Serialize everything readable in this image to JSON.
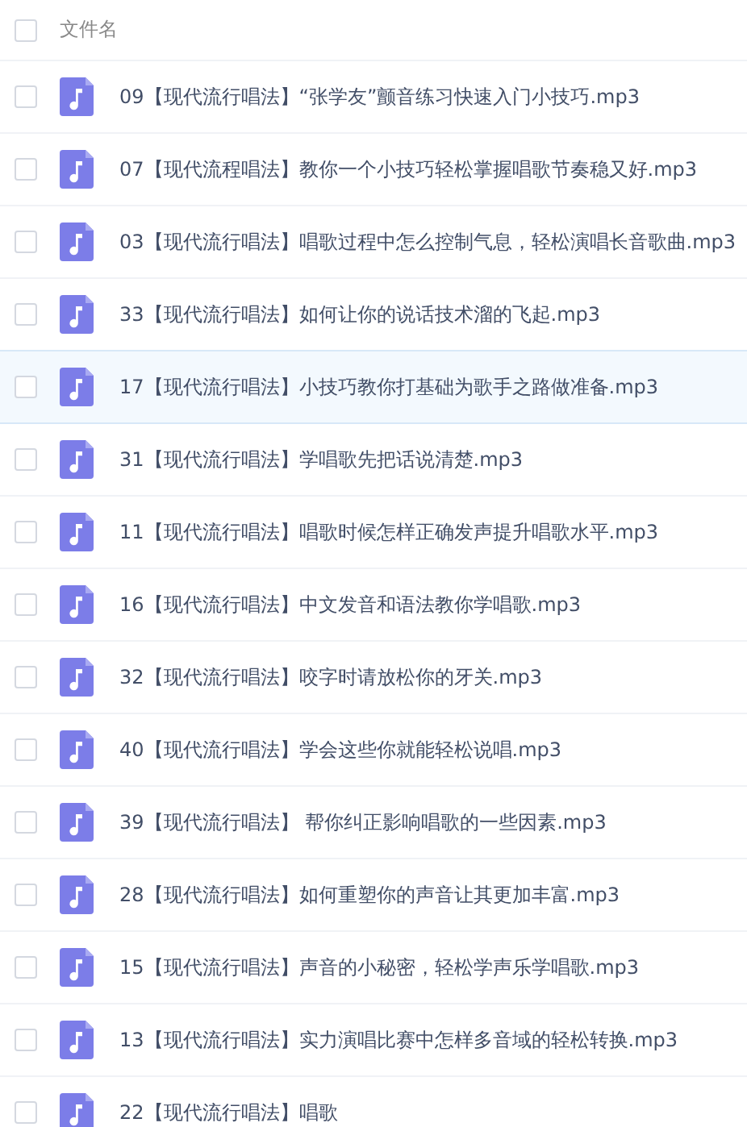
{
  "header": {
    "label": "文件名",
    "checked": false
  },
  "files": [
    {
      "name": "09【现代流行唱法】“张学友”颤音练习快速入门小技巧.mp3",
      "checked": false,
      "highlighted": false
    },
    {
      "name": "07【现代流程唱法】教你一个小技巧轻松掌握唱歌节奏稳又好.mp3",
      "checked": false,
      "highlighted": false
    },
    {
      "name": "03【现代流行唱法】唱歌过程中怎么控制气息，轻松演唱长音歌曲.mp3",
      "checked": false,
      "highlighted": false
    },
    {
      "name": "33【现代流行唱法】如何让你的说话技术溜的飞起.mp3",
      "checked": false,
      "highlighted": false
    },
    {
      "name": "17【现代流行唱法】小技巧教你打基础为歌手之路做准备.mp3",
      "checked": false,
      "highlighted": true
    },
    {
      "name": "31【现代流行唱法】学唱歌先把话说清楚.mp3",
      "checked": false,
      "highlighted": false
    },
    {
      "name": "11【现代流行唱法】唱歌时候怎样正确发声提升唱歌水平.mp3",
      "checked": false,
      "highlighted": false
    },
    {
      "name": "16【现代流行唱法】中文发音和语法教你学唱歌.mp3",
      "checked": false,
      "highlighted": false
    },
    {
      "name": "32【现代流行唱法】咬字时请放松你的牙关.mp3",
      "checked": false,
      "highlighted": false
    },
    {
      "name": "40【现代流行唱法】学会这些你就能轻松说唱.mp3",
      "checked": false,
      "highlighted": false
    },
    {
      "name": "39【现代流行唱法】 帮你纠正影响唱歌的一些因素.mp3",
      "checked": false,
      "highlighted": false
    },
    {
      "name": "28【现代流行唱法】如何重塑你的声音让其更加丰富.mp3",
      "checked": false,
      "highlighted": false
    },
    {
      "name": "15【现代流行唱法】声音的小秘密，轻松学声乐学唱歌.mp3",
      "checked": false,
      "highlighted": false
    },
    {
      "name": "13【现代流行唱法】实力演唱比赛中怎样多音域的轻松转换.mp3",
      "checked": false,
      "highlighted": false
    },
    {
      "name": "22【现代流行唱法】唱歌",
      "checked": false,
      "highlighted": false
    }
  ]
}
